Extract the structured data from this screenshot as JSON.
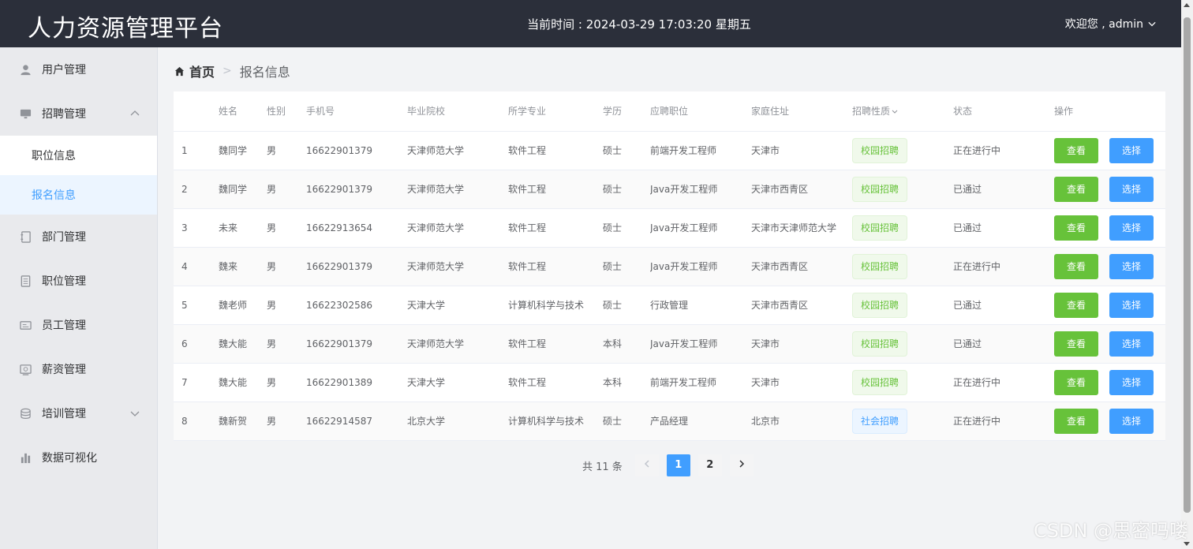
{
  "header": {
    "title": "人力资源管理平台",
    "clock": "当前时间 : 2024-03-29 17:03:20 星期五",
    "user": "欢迎您 , admin"
  },
  "sidebar": {
    "items": [
      {
        "label": "用户管理",
        "icon": "user-icon"
      },
      {
        "label": "招聘管理",
        "icon": "monitor-icon",
        "expanded": true,
        "children": [
          {
            "label": "职位信息"
          },
          {
            "label": "报名信息",
            "active": true
          }
        ]
      },
      {
        "label": "部门管理",
        "icon": "notebook-icon"
      },
      {
        "label": "职位管理",
        "icon": "document-icon"
      },
      {
        "label": "员工管理",
        "icon": "id-card-icon"
      },
      {
        "label": "薪资管理",
        "icon": "wallet-icon"
      },
      {
        "label": "培训管理",
        "icon": "coin-icon",
        "collapsed": true
      },
      {
        "label": "数据可视化",
        "icon": "bar-chart-icon"
      }
    ]
  },
  "breadcrumb": {
    "home": "首页",
    "current": "报名信息"
  },
  "table": {
    "columns": [
      "",
      "姓名",
      "性别",
      "手机号",
      "毕业院校",
      "所学专业",
      "学历",
      "应聘职位",
      "家庭住址",
      "招聘性质",
      "状态",
      "操作"
    ],
    "rows": [
      {
        "idx": "1",
        "name": "魏同学",
        "gender": "男",
        "phone": "16622901379",
        "school": "天津师范大学",
        "major": "软件工程",
        "degree": "硕士",
        "position": "前端开发工程师",
        "address": "天津市",
        "type": "校园招聘",
        "status": "正在进行中"
      },
      {
        "idx": "2",
        "name": "魏同学",
        "gender": "男",
        "phone": "16622901379",
        "school": "天津师范大学",
        "major": "软件工程",
        "degree": "硕士",
        "position": "Java开发工程师",
        "address": "天津市西青区",
        "type": "校园招聘",
        "status": "已通过"
      },
      {
        "idx": "3",
        "name": "未来",
        "gender": "男",
        "phone": "16622913654",
        "school": "天津师范大学",
        "major": "软件工程",
        "degree": "硕士",
        "position": "Java开发工程师",
        "address": "天津市天津师范大学",
        "type": "校园招聘",
        "status": "已通过"
      },
      {
        "idx": "4",
        "name": "魏来",
        "gender": "男",
        "phone": "16622901379",
        "school": "天津师范大学",
        "major": "软件工程",
        "degree": "硕士",
        "position": "Java开发工程师",
        "address": "天津市西青区",
        "type": "校园招聘",
        "status": "正在进行中"
      },
      {
        "idx": "5",
        "name": "魏老师",
        "gender": "男",
        "phone": "16622302586",
        "school": "天津大学",
        "major": "计算机科学与技术",
        "degree": "硕士",
        "position": "行政管理",
        "address": "天津市西青区",
        "type": "校园招聘",
        "status": "已通过"
      },
      {
        "idx": "6",
        "name": "魏大能",
        "gender": "男",
        "phone": "16622901379",
        "school": "天津师范大学",
        "major": "软件工程",
        "degree": "本科",
        "position": "Java开发工程师",
        "address": "天津市",
        "type": "校园招聘",
        "status": "已通过"
      },
      {
        "idx": "7",
        "name": "魏大能",
        "gender": "男",
        "phone": "16622901389",
        "school": "天津大学",
        "major": "软件工程",
        "degree": "本科",
        "position": "前端开发工程师",
        "address": "天津市",
        "type": "校园招聘",
        "status": "正在进行中"
      },
      {
        "idx": "8",
        "name": "魏新贺",
        "gender": "男",
        "phone": "16622914587",
        "school": "北京大学",
        "major": "计算机科学与技术",
        "degree": "硕士",
        "position": "产品经理",
        "address": "北京市",
        "type": "社会招聘",
        "status": "正在进行中"
      }
    ],
    "view_label": "查看",
    "select_label": "选择"
  },
  "pagination": {
    "total": "共 11 条",
    "pages": [
      "1",
      "2"
    ],
    "current": "1"
  },
  "watermark": "CSDN @思密吗喽",
  "colors": {
    "header_bg": "#2b2f3a",
    "primary": "#409eff",
    "success": "#67c23a"
  }
}
